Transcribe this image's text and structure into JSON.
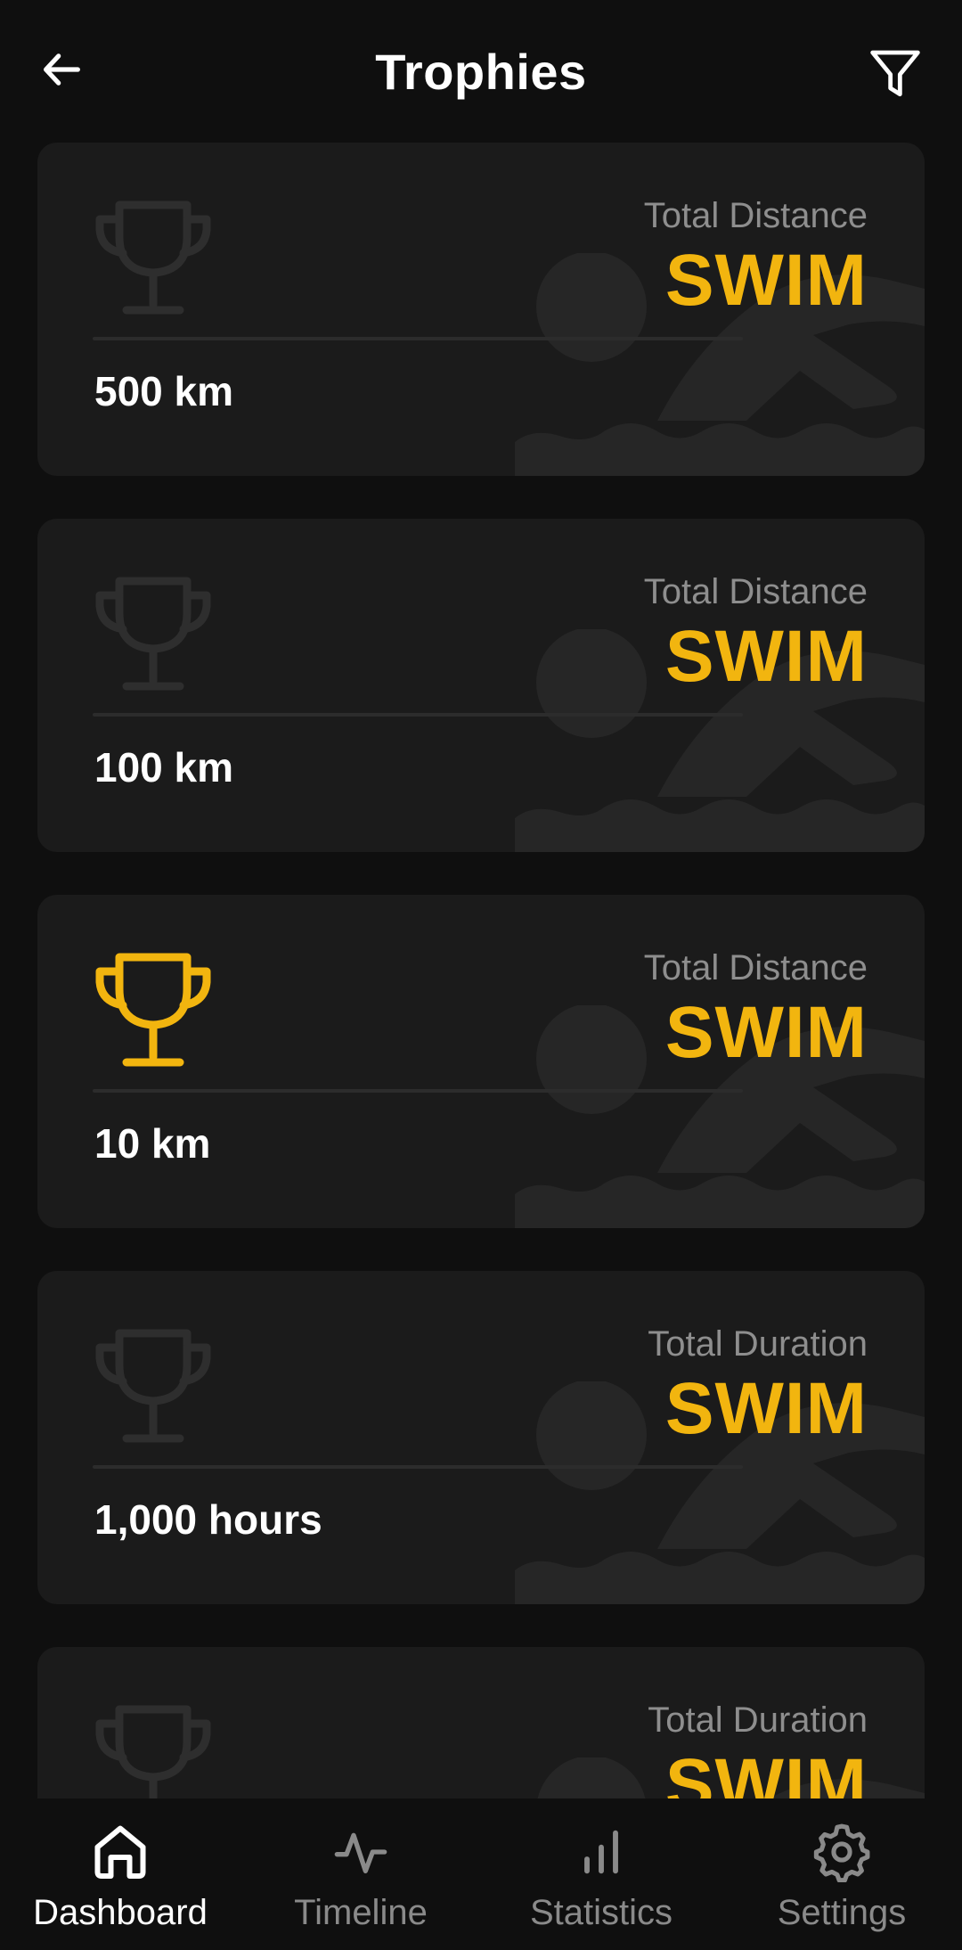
{
  "header": {
    "title": "Trophies",
    "back_icon": "arrow-left-icon",
    "filter_icon": "filter-icon"
  },
  "colors": {
    "background": "#0f0f0f",
    "card": "#1b1b1b",
    "accent": "#f2b50f",
    "trophy_locked": "#2e2e2e",
    "muted_text": "#8e8e8e"
  },
  "trophies": [
    {
      "metric": "Total Distance",
      "sport": "SWIM",
      "goal": "500 km",
      "achieved": false
    },
    {
      "metric": "Total Distance",
      "sport": "SWIM",
      "goal": "100 km",
      "achieved": false
    },
    {
      "metric": "Total Distance",
      "sport": "SWIM",
      "goal": "10 km",
      "achieved": true
    },
    {
      "metric": "Total Duration",
      "sport": "SWIM",
      "goal": "1,000 hours",
      "achieved": false
    },
    {
      "metric": "Total Duration",
      "sport": "SWIM",
      "goal": "",
      "achieved": false
    }
  ],
  "nav": {
    "items": [
      {
        "label": "Dashboard",
        "icon": "home-icon",
        "active": true
      },
      {
        "label": "Timeline",
        "icon": "activity-icon",
        "active": false
      },
      {
        "label": "Statistics",
        "icon": "bar-chart-icon",
        "active": false
      },
      {
        "label": "Settings",
        "icon": "gear-icon",
        "active": false
      }
    ]
  }
}
